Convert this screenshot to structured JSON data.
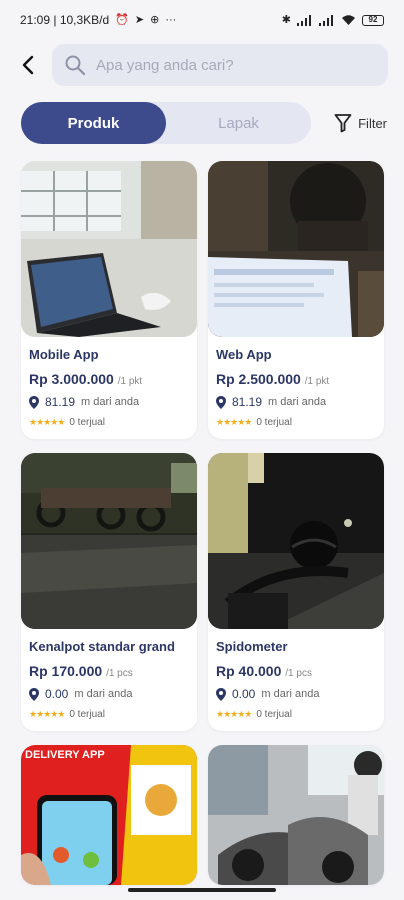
{
  "status_bar": {
    "left_text": "21:09 | 10,3KB/d",
    "more": "···",
    "battery": "92"
  },
  "search": {
    "placeholder": "Apa yang anda cari?"
  },
  "tabs": [
    {
      "label": "Produk",
      "active": true
    },
    {
      "label": "Lapak",
      "active": false
    }
  ],
  "filter_label": "Filter",
  "products": [
    {
      "title": "Mobile App",
      "price": "Rp 3.000.000",
      "unit": "/1 pkt",
      "distance": "81.19",
      "distance_suffix": "m dari anda",
      "sold": "0 terjual"
    },
    {
      "title": "Web App",
      "price": "Rp 2.500.000",
      "unit": "/1 pkt",
      "distance": "81.19",
      "distance_suffix": "m dari anda",
      "sold": "0 terjual"
    },
    {
      "title": "Kenalpot standar grand",
      "price": "Rp 170.000",
      "unit": "/1 pcs",
      "distance": "0.00",
      "distance_suffix": "m dari anda",
      "sold": "0 terjual"
    },
    {
      "title": "Spidometer",
      "price": "Rp 40.000",
      "unit": "/1 pcs",
      "distance": "0.00",
      "distance_suffix": "m dari anda",
      "sold": "0 terjual"
    }
  ],
  "partial_card_caption": "DELIVERY APP",
  "colors": {
    "primary": "#3d4a8c",
    "star": "#f2b01e",
    "background": "#f5f5f8"
  }
}
